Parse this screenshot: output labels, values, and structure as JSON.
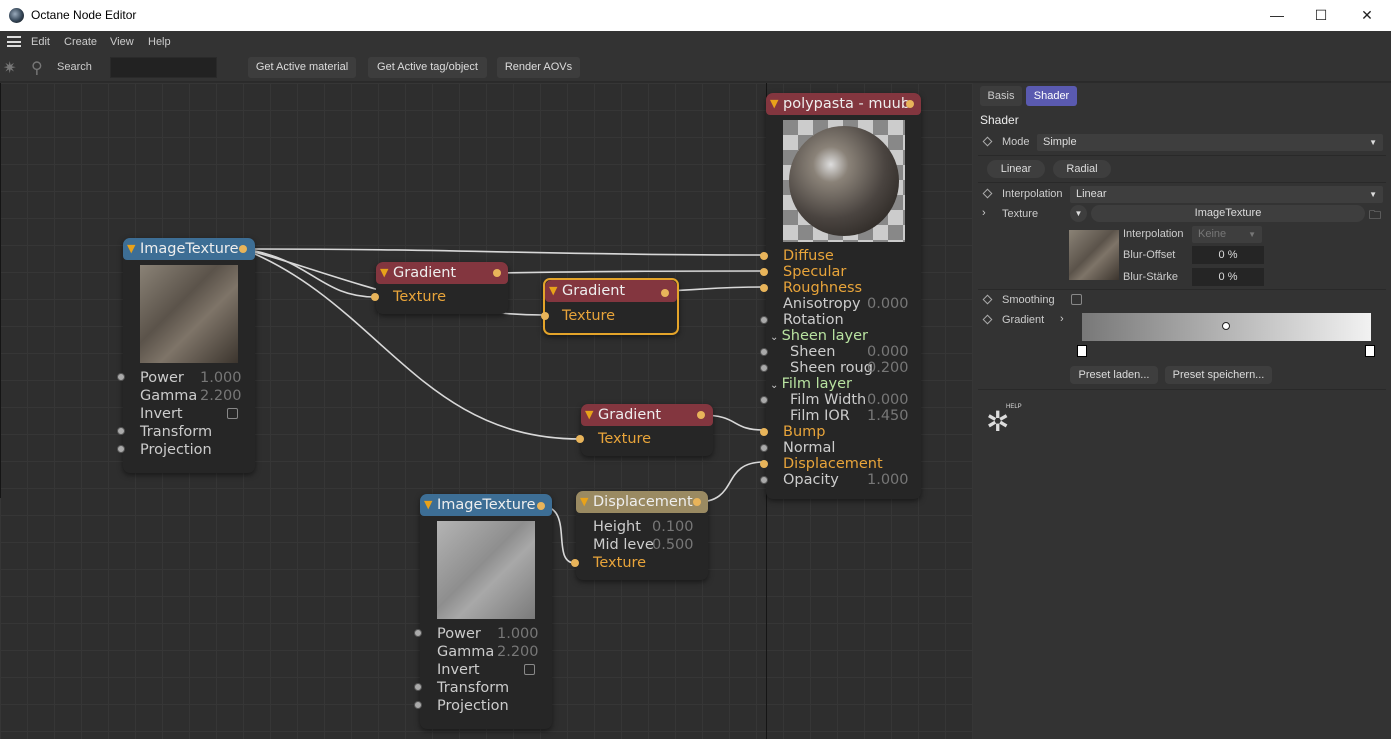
{
  "window": {
    "title": "Octane Node Editor",
    "minimize": "—",
    "maximize": "☐",
    "close": "✕"
  },
  "menu": {
    "items": [
      "Edit",
      "Create",
      "View",
      "Help"
    ]
  },
  "toolbar": {
    "search_label": "Search",
    "search_value": "",
    "buttons": [
      "Get Active material",
      "Get Active tag/object",
      "Render AOVs"
    ]
  },
  "nodes": {
    "image1": {
      "title": "ImageTexture",
      "power_label": "Power",
      "power": "1.000",
      "gamma_label": "Gamma",
      "gamma": "2.200",
      "invert_label": "Invert",
      "transform_label": "Transform",
      "projection_label": "Projection"
    },
    "gradient1": {
      "title": "Gradient",
      "texture_label": "Texture"
    },
    "gradient2": {
      "title": "Gradient",
      "texture_label": "Texture"
    },
    "gradient3": {
      "title": "Gradient",
      "texture_label": "Texture"
    },
    "material": {
      "title": "polypasta - muub",
      "diffuse": "Diffuse",
      "specular": "Specular",
      "roughness": "Roughness",
      "anisotropy": "Anisotropy",
      "anisotropy_val": "0.000",
      "rotation": "Rotation",
      "sheen_layer": "Sheen layer",
      "sheen": "Sheen",
      "sheen_val": "0.000",
      "sheen_rough": "Sheen roug",
      "sheen_rough_val": "0.200",
      "film_layer": "Film layer",
      "film_width": "Film Width",
      "film_width_val": "0.000",
      "film_ior": "Film IOR",
      "film_ior_val": "1.450",
      "bump": "Bump",
      "normal": "Normal",
      "displacement": "Displacement",
      "opacity": "Opacity",
      "opacity_val": "1.000"
    },
    "image2": {
      "title": "ImageTexture",
      "power_label": "Power",
      "power": "1.000",
      "gamma_label": "Gamma",
      "gamma": "2.200",
      "invert_label": "Invert",
      "transform_label": "Transform",
      "projection_label": "Projection"
    },
    "displacement": {
      "title": "Displacement",
      "height_label": "Height",
      "height": "0.100",
      "mid_label": "Mid leve",
      "mid": "0.500",
      "texture_label": "Texture"
    }
  },
  "panel": {
    "tabs": [
      "Basis",
      "Shader"
    ],
    "active_tab": "Shader",
    "section_title": "Shader",
    "mode_label": "Mode",
    "mode_value": "Simple",
    "type_buttons": [
      "Linear",
      "Radial"
    ],
    "interpolation_label": "Interpolation",
    "interpolation_value": "Linear",
    "texture_label": "Texture",
    "texture_value": "ImageTexture",
    "sub_interpolation_label": "Interpolation",
    "sub_interpolation_value": "Keine",
    "blur_offset_label": "Blur-Offset",
    "blur_offset_value": "0 %",
    "blur_strength_label": "Blur-Stärke",
    "blur_strength_value": "0 %",
    "smoothing_label": "Smoothing",
    "gradient_label": "Gradient",
    "preset_load": "Preset laden...",
    "preset_save": "Preset speichern...",
    "help_label": "HELP"
  }
}
